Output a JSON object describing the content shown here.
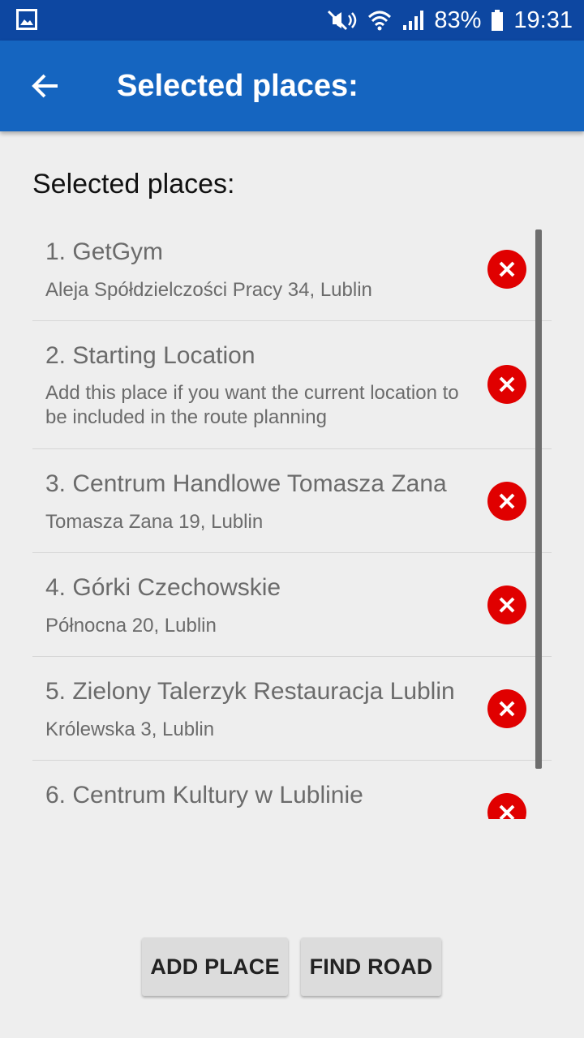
{
  "status_bar": {
    "battery_percent": "83%",
    "time": "19:31",
    "icons": [
      "gallery-icon",
      "mute-icon",
      "wifi-icon",
      "signal-icon",
      "battery-icon"
    ]
  },
  "app_bar": {
    "title": "Selected places:",
    "back_icon": "arrow-left-icon"
  },
  "main": {
    "heading": "Selected places:",
    "places": [
      {
        "title": "1. GetGym",
        "subtitle": "Aleja Spółdzielczości Pracy 34, Lublin"
      },
      {
        "title": "2. Starting Location",
        "subtitle": "Add this place if you want the current location to be included in the route planning"
      },
      {
        "title": "3. Centrum Handlowe Tomasza Zana",
        "subtitle": "Tomasza Zana 19, Lublin"
      },
      {
        "title": "4. Górki Czechowskie",
        "subtitle": "Północna 20, Lublin"
      },
      {
        "title": "5. Zielony Talerzyk Restauracja Lublin",
        "subtitle": "Królewska 3, Lublin"
      },
      {
        "title": "6. Centrum Kultury w Lublinie",
        "subtitle": ""
      }
    ],
    "remove_icon": "remove-circle-icon"
  },
  "buttons": {
    "add_place": "ADD PLACE",
    "find_road": "FIND ROAD"
  },
  "colors": {
    "status_bar": "#0d47a1",
    "app_bar": "#1565c0",
    "remove": "#e00000",
    "background": "#eeeeee"
  }
}
